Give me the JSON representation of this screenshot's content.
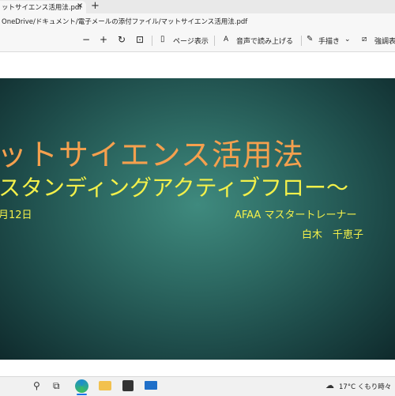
{
  "tab": {
    "title": "ットサイエンス活用法.pdf",
    "close_glyph": "×",
    "new_tab_glyph": "+"
  },
  "address": {
    "url": "OneDrive/ドキュメント/電子メールの添付ファイル/マットサイエンス活用法.pdf"
  },
  "pdf_toolbar": {
    "zoom_out": "−",
    "zoom_in": "+",
    "rotate": "↻",
    "fit": "⊡",
    "page_view_label": "ページ表示",
    "read_aloud_label": "音声で読み上げる",
    "draw_label": "手描き",
    "highlight_label": "強調表"
  },
  "slide": {
    "title": "ットサイエンス活用法",
    "subtitle": "スタンディングアクティブフロー～",
    "date": "月12日",
    "role": "AFAA マスタートレーナー",
    "name": "白木　千恵子",
    "colors": {
      "title": "#f5a04e",
      "text": "#f3f04a",
      "background": "#2d6a63"
    }
  },
  "taskbar": {
    "search_icon": "search-icon",
    "task_view_icon": "task-view-icon",
    "weather_text": "17°C くもり時々"
  }
}
